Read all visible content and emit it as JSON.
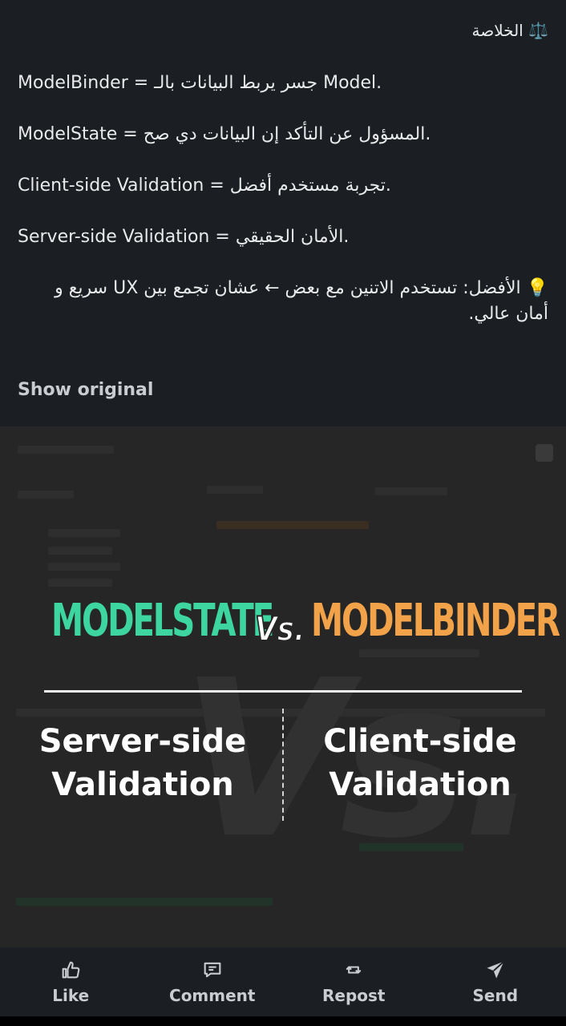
{
  "post": {
    "heading": "⚖️ الخلاصة",
    "paragraphs": [
      "ModelBinder = جسر يربط البيانات بالـ Model.",
      "ModelState = المسؤول عن التأكد إن البيانات دي صح.",
      "Client-side Validation = تجربة مستخدم أفضل.",
      "Server-side Validation = الأمان الحقيقي.",
      "💡 الأفضل: تستخدم الاتنين مع بعض ← عشان تجمع بين UX سريع و أمان عالي."
    ],
    "show_original": "Show original"
  },
  "banner": {
    "title_left": "MODELSTATE",
    "title_vs": "Vs.",
    "title_right": "MODELBINDER",
    "col_left": "Server-side Validation",
    "col_right": "Client-side Validation",
    "colors": {
      "left": "#3dd6a0",
      "right": "#f2a34a"
    }
  },
  "actions": [
    {
      "label": "Like",
      "icon": "thumbs-up-icon"
    },
    {
      "label": "Comment",
      "icon": "comment-icon"
    },
    {
      "label": "Repost",
      "icon": "repost-icon"
    },
    {
      "label": "Send",
      "icon": "send-icon"
    }
  ]
}
